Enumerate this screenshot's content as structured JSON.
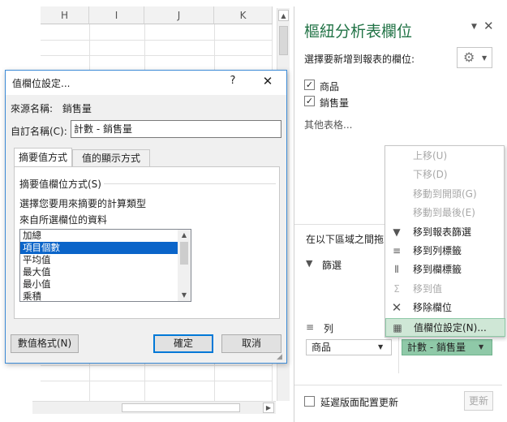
{
  "sheet": {
    "columns": [
      "H",
      "I",
      "J",
      "K"
    ]
  },
  "dialog": {
    "title": "值欄位設定...",
    "help": "?",
    "close": "✕",
    "source_label": "來源名稱:",
    "source_value": "銷售量",
    "custom_name_label": "自訂名稱(C):",
    "custom_name_value": "計數 - 銷售量",
    "tabs": [
      "摘要值方式",
      "值的顯示方式"
    ],
    "summarize_label": "摘要值欄位方式(S)",
    "desc_line1": "選擇您要用來摘要的計算類型",
    "desc_line2": "來自所選欄位的資料",
    "list": [
      "加總",
      "項目個數",
      "平均值",
      "最大值",
      "最小值",
      "乘積"
    ],
    "selected_index": 1,
    "number_format_button": "數值格式(N)",
    "ok_button": "確定",
    "cancel_button": "取消"
  },
  "panel": {
    "title": "樞紐分析表欄位",
    "choose_fields": "選擇要新增到報表的欄位:",
    "fields": [
      {
        "label": "商品",
        "checked": true
      },
      {
        "label": "銷售量",
        "checked": true
      }
    ],
    "more_tables": "其他表格...",
    "drag_between": "在以下區域之間拖",
    "filters_label": "篩選",
    "rows_label": "列",
    "rows_value": "商品",
    "values_value": "計數 - 銷售量",
    "defer_label": "延遲版面配置更新",
    "update_button": "更新"
  },
  "context_menu": {
    "items": [
      {
        "label": "上移(U)",
        "enabled": false,
        "icon": ""
      },
      {
        "label": "下移(D)",
        "enabled": false,
        "icon": ""
      },
      {
        "label": "移動到開頭(G)",
        "enabled": false,
        "icon": ""
      },
      {
        "label": "移動到最後(E)",
        "enabled": false,
        "icon": ""
      },
      {
        "label": "移到報表篩選",
        "enabled": true,
        "icon": "filter-icon"
      },
      {
        "label": "移到列標籤",
        "enabled": true,
        "icon": "rows-icon"
      },
      {
        "label": "移到欄標籤",
        "enabled": true,
        "icon": "columns-icon"
      },
      {
        "label": "移到值",
        "enabled": false,
        "icon": "sigma-icon"
      },
      {
        "label": "移除欄位",
        "enabled": true,
        "icon": "remove-icon"
      },
      {
        "label": "值欄位設定(N)...",
        "enabled": true,
        "icon": "field-settings-icon"
      }
    ],
    "highlighted_index": 9
  },
  "colors": {
    "selection_blue": "#0a64c9",
    "pivot_green": "#217346",
    "menu_highlight": "#cfe7d6",
    "value_chip": "#8fc9a8"
  }
}
